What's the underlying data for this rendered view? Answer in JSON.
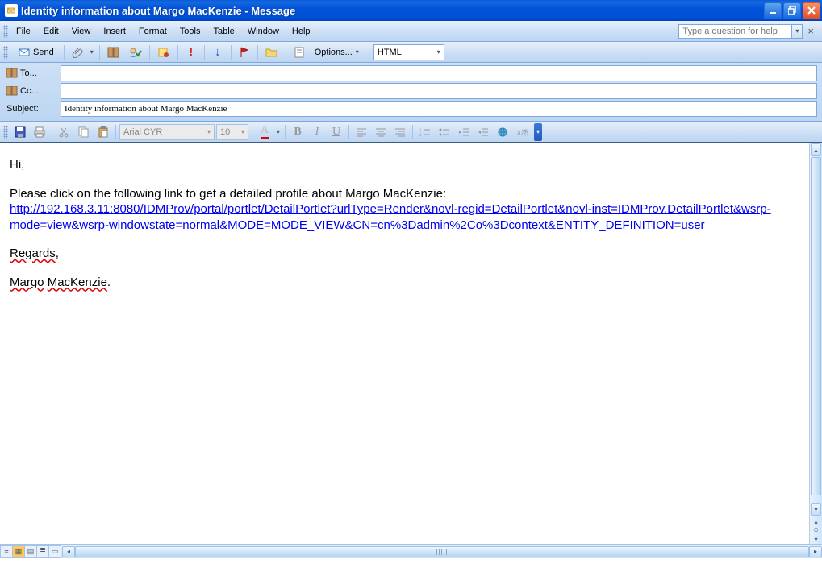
{
  "window": {
    "title": "Identity information about Margo MacKenzie - Message"
  },
  "menu": {
    "items": [
      "File",
      "Edit",
      "View",
      "Insert",
      "Format",
      "Tools",
      "Table",
      "Window",
      "Help"
    ],
    "help_placeholder": "Type a question for help"
  },
  "toolbar": {
    "send_label": "Send",
    "options_label": "Options...",
    "format_value": "HTML"
  },
  "address": {
    "to_label": "To...",
    "cc_label": "Cc...",
    "subject_label": "Subject:",
    "to_value": "",
    "cc_value": "",
    "subject_value": "Identity information about Margo MacKenzie"
  },
  "formatting": {
    "font_value": "Arial CYR",
    "size_value": "10"
  },
  "body": {
    "greeting": "Hi,",
    "intro": "Please click on the following link to get a detailed profile about Margo MacKenzie:",
    "link": "http://192.168.3.11:8080/IDMProv/portal/portlet/DetailPortlet?urlType=Render&novl-regid=DetailPortlet&novl-inst=IDMProv.DetailPortlet&wsrp-mode=view&wsrp-windowstate=normal&MODE=MODE_VIEW&CN=cn%3Dadmin%2Co%3Dcontext&ENTITY_DEFINITION=user",
    "regards": "Regards",
    "signature_first": "Margo",
    "signature_last": "MacKenzie"
  }
}
